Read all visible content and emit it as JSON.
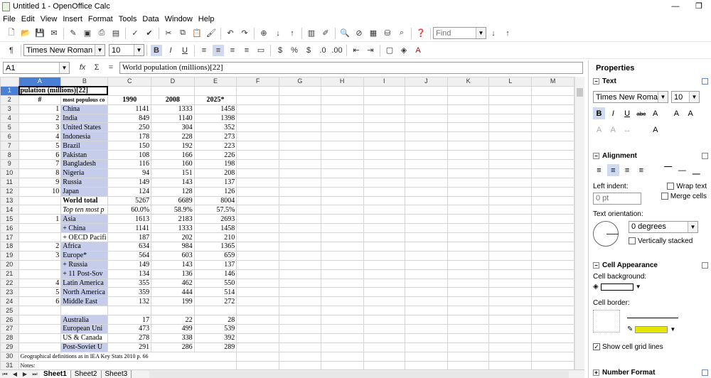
{
  "window": {
    "title": "Untitled 1 - OpenOffice Calc",
    "minimize": "—",
    "restore": "❐"
  },
  "menu": [
    "File",
    "Edit",
    "View",
    "Insert",
    "Format",
    "Tools",
    "Data",
    "Window",
    "Help"
  ],
  "toolbar": {
    "find_placeholder": "Find",
    "font_name": "Times New Roman",
    "font_size": "10"
  },
  "formula": {
    "namebox": "A1",
    "content": "World population (millions)[22]"
  },
  "columns": [
    "A",
    "B",
    "C",
    "D",
    "E",
    "F",
    "G",
    "H",
    "I",
    "J",
    "K",
    "L",
    "M"
  ],
  "rows": [
    {
      "n": "1",
      "a": "pulation (millions)[22]",
      "b": "",
      "c": "",
      "d": "",
      "e": ""
    },
    {
      "n": "2",
      "a": "#",
      "b": "most populous co",
      "c": "1990",
      "d": "2008",
      "e": "2025*"
    },
    {
      "n": "3",
      "a": "1",
      "b": "China",
      "c": "1141",
      "d": "1333",
      "e": "1458"
    },
    {
      "n": "4",
      "a": "2",
      "b": "India",
      "c": "849",
      "d": "1140",
      "e": "1398"
    },
    {
      "n": "5",
      "a": "3",
      "b": "United States",
      "c": "250",
      "d": "304",
      "e": "352"
    },
    {
      "n": "6",
      "a": "4",
      "b": "Indonesia",
      "c": "178",
      "d": "228",
      "e": "273"
    },
    {
      "n": "7",
      "a": "5",
      "b": "Brazil",
      "c": "150",
      "d": "192",
      "e": "223"
    },
    {
      "n": "8",
      "a": "6",
      "b": "Pakistan",
      "c": "108",
      "d": "166",
      "e": "226"
    },
    {
      "n": "9",
      "a": "7",
      "b": "Bangladesh",
      "c": "116",
      "d": "160",
      "e": "198"
    },
    {
      "n": "10",
      "a": "8",
      "b": "Nigeria",
      "c": "94",
      "d": "151",
      "e": "208"
    },
    {
      "n": "11",
      "a": "9",
      "b": "Russia",
      "c": "149",
      "d": "143",
      "e": "137"
    },
    {
      "n": "12",
      "a": "10",
      "b": "Japan",
      "c": "124",
      "d": "128",
      "e": "126"
    },
    {
      "n": "13",
      "a": "",
      "b": "World total",
      "c": "5267",
      "d": "6689",
      "e": "8004"
    },
    {
      "n": "14",
      "a": "",
      "b": "Top ten most p",
      "c": "60.0%",
      "d": "58.9%",
      "e": "57.5%"
    },
    {
      "n": "15",
      "a": "1",
      "b": "Asia",
      "c": "1613",
      "d": "2183",
      "e": "2693"
    },
    {
      "n": "16",
      "a": "",
      "b": "+ China",
      "c": "1141",
      "d": "1333",
      "e": "1458"
    },
    {
      "n": "17",
      "a": "",
      "b": "+ OECD Pacifi",
      "c": "187",
      "d": "202",
      "e": "210"
    },
    {
      "n": "18",
      "a": "2",
      "b": "Africa",
      "c": "634",
      "d": "984",
      "e": "1365"
    },
    {
      "n": "19",
      "a": "3",
      "b": "Europe*",
      "c": "564",
      "d": "603",
      "e": "659"
    },
    {
      "n": "20",
      "a": "",
      "b": "+ Russia",
      "c": "149",
      "d": "143",
      "e": "137"
    },
    {
      "n": "21",
      "a": "",
      "b": "+ 11 Post-Sov",
      "c": "134",
      "d": "136",
      "e": "146"
    },
    {
      "n": "22",
      "a": "4",
      "b": "Latin America",
      "c": "355",
      "d": "462",
      "e": "550"
    },
    {
      "n": "23",
      "a": "5",
      "b": "North America",
      "c": "359",
      "d": "444",
      "e": "514"
    },
    {
      "n": "24",
      "a": "6",
      "b": "Middle East",
      "c": "132",
      "d": "199",
      "e": "272"
    },
    {
      "n": "25",
      "a": "",
      "b": "",
      "c": "",
      "d": "",
      "e": ""
    },
    {
      "n": "26",
      "a": "",
      "b": "Australia",
      "c": "17",
      "d": "22",
      "e": "28"
    },
    {
      "n": "27",
      "a": "",
      "b": "European Uni",
      "c": "473",
      "d": "499",
      "e": "539"
    },
    {
      "n": "28",
      "a": "",
      "b": "US & Canada",
      "c": "278",
      "d": "338",
      "e": "392"
    },
    {
      "n": "29",
      "a": "",
      "b": "Post-Soviet U",
      "c": "291",
      "d": "286",
      "e": "289"
    },
    {
      "n": "30",
      "a": "Geographical definitions as in IEA Key Stats 2010 p. 66",
      "b": "",
      "c": "",
      "d": "",
      "e": ""
    },
    {
      "n": "31",
      "a": "Notes:",
      "b": "",
      "c": "",
      "d": "",
      "e": ""
    }
  ],
  "sheet_tabs": [
    "Sheet1",
    "Sheet2",
    "Sheet3"
  ],
  "sidebar": {
    "title": "Properties",
    "text_section": "Text",
    "font_name": "Times New Roman",
    "font_size": "10",
    "alignment_section": "Alignment",
    "left_indent_label": "Left indent:",
    "left_indent_value": "0 pt",
    "wrap_text": "Wrap text",
    "merge_cells": "Merge cells",
    "text_orientation_label": "Text orientation:",
    "orientation_value": "0 degrees",
    "vertically_stacked": "Vertically stacked",
    "cell_appearance_section": "Cell Appearance",
    "cell_background_label": "Cell background:",
    "cell_border_label": "Cell border:",
    "show_grid_lines": "Show cell grid lines",
    "number_format_section": "Number Format"
  }
}
